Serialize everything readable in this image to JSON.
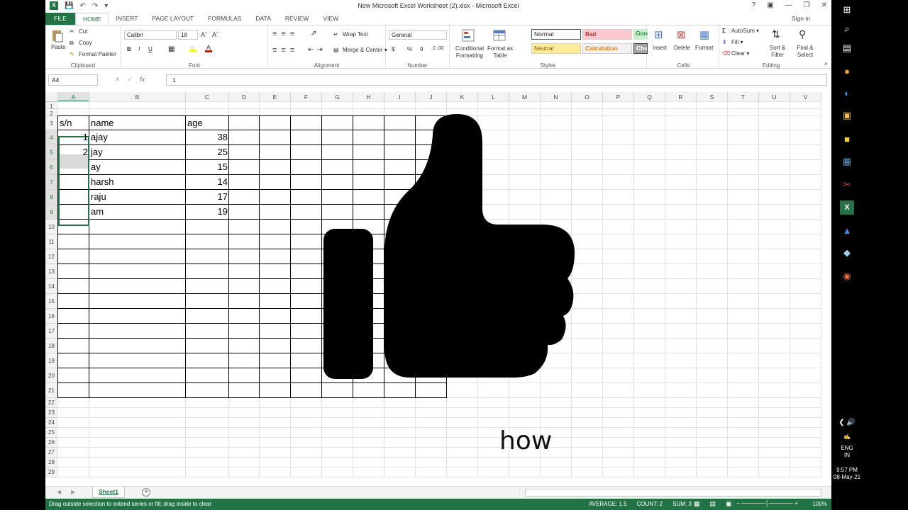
{
  "window": {
    "title": "New Microsoft Excel Worksheet (2).xlsx - Microsoft Excel",
    "app_icon": "X",
    "controls": [
      "?",
      "❐",
      "—",
      "❐",
      "✕"
    ]
  },
  "ribbon_tabs": [
    "FILE",
    "HOME",
    "INSERT",
    "PAGE LAYOUT",
    "FORMULAS",
    "DATA",
    "REVIEW",
    "VIEW"
  ],
  "sign_in": "Sign in",
  "clipboard": {
    "paste": "Paste",
    "cut": "Cut",
    "copy": "Copy",
    "format_painter": "Format Painter",
    "label": "Clipboard"
  },
  "font": {
    "name": "Calibri",
    "size": "18",
    "label": "Font",
    "bold": "B",
    "italic": "I",
    "underline": "U"
  },
  "alignment": {
    "wrap": "Wrap Text",
    "merge": "Merge & Center",
    "label": "Alignment"
  },
  "number": {
    "format": "General",
    "currency": "$",
    "percent": "%",
    "comma": "9",
    "label": "Number"
  },
  "styles": {
    "conditional": "Conditional Formatting",
    "format_table": "Format as Table",
    "normal": "Normal",
    "bad": "Bad",
    "good": "Good",
    "neutral": "Neutral",
    "calculation": "Calculation",
    "check_cell": "Check Cell",
    "label": "Styles"
  },
  "cells_grp": {
    "insert": "Insert",
    "delete": "Delete",
    "format": "Format",
    "label": "Cells"
  },
  "editing": {
    "autosum": "AutoSum",
    "fill": "Fill",
    "clear": "Clear",
    "sort": "Sort & Filter",
    "find": "Find & Select",
    "label": "Editing"
  },
  "formula_bar": {
    "name_box": "A4",
    "fx": "fx",
    "value": "1"
  },
  "columns": [
    "A",
    "B",
    "C",
    "D",
    "E",
    "F",
    "G",
    "H",
    "I",
    "J",
    "K",
    "L",
    "M",
    "N",
    "O",
    "P",
    "Q",
    "R",
    "S",
    "T",
    "U",
    "V"
  ],
  "rows": [
    "1",
    "2",
    "3",
    "4",
    "5",
    "6",
    "7",
    "8",
    "9",
    "10",
    "11",
    "12",
    "13",
    "14",
    "15",
    "16",
    "17",
    "18",
    "19",
    "20",
    "21",
    "22",
    "23",
    "24",
    "25",
    "26",
    "27",
    "28",
    "29"
  ],
  "table": {
    "headers": [
      "s/n",
      "name",
      "age"
    ],
    "rows": [
      [
        "1",
        "ajay",
        "38"
      ],
      [
        "2",
        "jay",
        "25"
      ],
      [
        "",
        "ay",
        "15"
      ],
      [
        "",
        "harsh",
        "14"
      ],
      [
        "",
        "raju",
        "17"
      ],
      [
        "",
        "am",
        "19"
      ]
    ]
  },
  "overlay_text": "how",
  "sheet_tab": "Sheet1",
  "status": {
    "message": "Drag outside selection to extend series or fill; drag inside to clear",
    "average": "AVERAGE: 1.5",
    "count": "COUNT: 2",
    "sum": "SUM: 3",
    "zoom": "100%"
  },
  "taskbar": {
    "icons": [
      "windows-icon",
      "search-icon",
      "task-view-icon",
      "chrome-icon",
      "edge-icon",
      "file-explorer-icon",
      "sticky-notes-icon",
      "calculator-icon",
      "snip-icon",
      "excel-icon",
      "photos-icon",
      "paint-icon",
      "powerpoint-icon"
    ],
    "lang": "ENG",
    "region": "IN",
    "time": "9:57 PM",
    "date": "08-May-21"
  },
  "colors": {
    "accent": "#217346",
    "bad_bg": "#ffc7ce",
    "good_bg": "#c6efce",
    "neutral_bg": "#ffeb9c"
  }
}
